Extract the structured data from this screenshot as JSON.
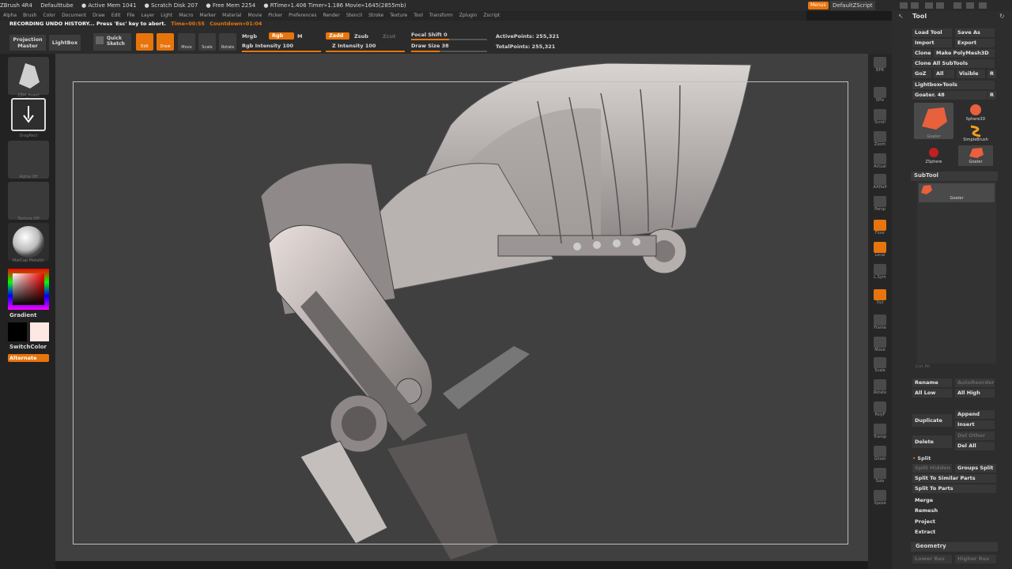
{
  "title_bar": {
    "items": [
      "ZBrush 4R4",
      "Defaulttube",
      "● Active Mem 1041",
      "● Scratch Disk 207",
      "● Free Mem 2254",
      "● RTime»1.406 Timer»1.186 Movie»1645(2855mb)"
    ],
    "menus_label": "Menus",
    "script_label": "DefaultZScript"
  },
  "menu_bar": [
    "Alpha",
    "Brush",
    "Color",
    "Document",
    "Draw",
    "Edit",
    "File",
    "Layer",
    "Light",
    "Macro",
    "Marker",
    "Material",
    "Movie",
    "Picker",
    "Preferences",
    "Render",
    "Stencil",
    "Stroke",
    "Texture",
    "Tool",
    "Transform",
    "Zplugin",
    "Zscript"
  ],
  "status": {
    "recording": "RECORDING UNDO HISTORY... Press 'Esc' key to abort.",
    "time": "Time»00:55",
    "countdown": "Countdown»01:04"
  },
  "toolbar": {
    "projection_master": "Projection Master",
    "lightbox": "LightBox",
    "quick_sketch": "Quick Sketch",
    "edit": "Edit",
    "draw": "Draw",
    "move": "Move",
    "scale": "Scale",
    "rotate": "Rotate",
    "mrgb": "Mrgb",
    "rgb": "Rgb",
    "m": "M",
    "rgb_intensity": "Rgb Intensity 100",
    "zadd": "Zadd",
    "zsub": "Zsub",
    "zcut": "Zcut",
    "z_intensity": "Z Intensity 100",
    "focal_shift": "Focal Shift 0",
    "draw_size": "Draw Size 38",
    "active_points": "ActivePoints: 255,321",
    "total_points": "TotalPoints: 255,321"
  },
  "left_shelf": {
    "brush_label": "ZBM_Insert",
    "stroke_label": "DragRect",
    "alpha_label": "Alpha Off",
    "texture_label": "Texture Off",
    "material_label": "MatCap Metallic",
    "gradient": "Gradient",
    "switch_color": "SwitchColor",
    "alternate": "Alternate"
  },
  "right_shelf": [
    "BPR",
    "SPix",
    "Scroll",
    "Zoom",
    "Actual",
    "AAHalf",
    "Persp",
    "Floor",
    "Local",
    "L.Sym",
    "Xyz",
    "Frame",
    "Move",
    "Scale",
    "Rotate",
    "PolyF",
    "Transp",
    "Ghost",
    "Solo",
    "Xpose"
  ],
  "tool_panel": {
    "title": "Tool",
    "load_tool": "Load Tool",
    "save_as": "Save As",
    "import": "Import",
    "export": "Export",
    "clone": "Clone",
    "make_polymesh": "Make PolyMesh3D",
    "clone_all": "Clone All SubTools",
    "goz": "GoZ",
    "all": "All",
    "visible": "Visible",
    "r": "R",
    "lightbox_tools": "Lightbox▸Tools",
    "current_tool": "Goater. 48",
    "thumbs": [
      "Goater",
      "Sphere3D",
      "SimpleBrush",
      "ZSphere",
      "Goater"
    ],
    "subtool_header": "SubTool",
    "subtool_item": "Goater",
    "list_all": "List All",
    "rename": "Rename",
    "auto_reorder": "AutoReorder",
    "all_low": "All Low",
    "all_high": "All High",
    "duplicate": "Duplicate",
    "append": "Append",
    "insert": "Insert",
    "delete": "Delete",
    "del_other": "Del Other",
    "del_all": "Del All",
    "split": "Split",
    "split_hidden": "Split Hidden",
    "groups_split": "Groups Split",
    "split_similar": "Split To Similar Parts",
    "split_parts": "Split To Parts",
    "merge": "Merge",
    "remesh": "Remesh",
    "project": "Project",
    "extract": "Extract",
    "geometry": "Geometry",
    "lower_res": "Lower Res",
    "higher_res": "Higher Res"
  },
  "colors": {
    "accent": "#e8740c",
    "canvas": "#404040",
    "panel": "#2d2d2d"
  }
}
